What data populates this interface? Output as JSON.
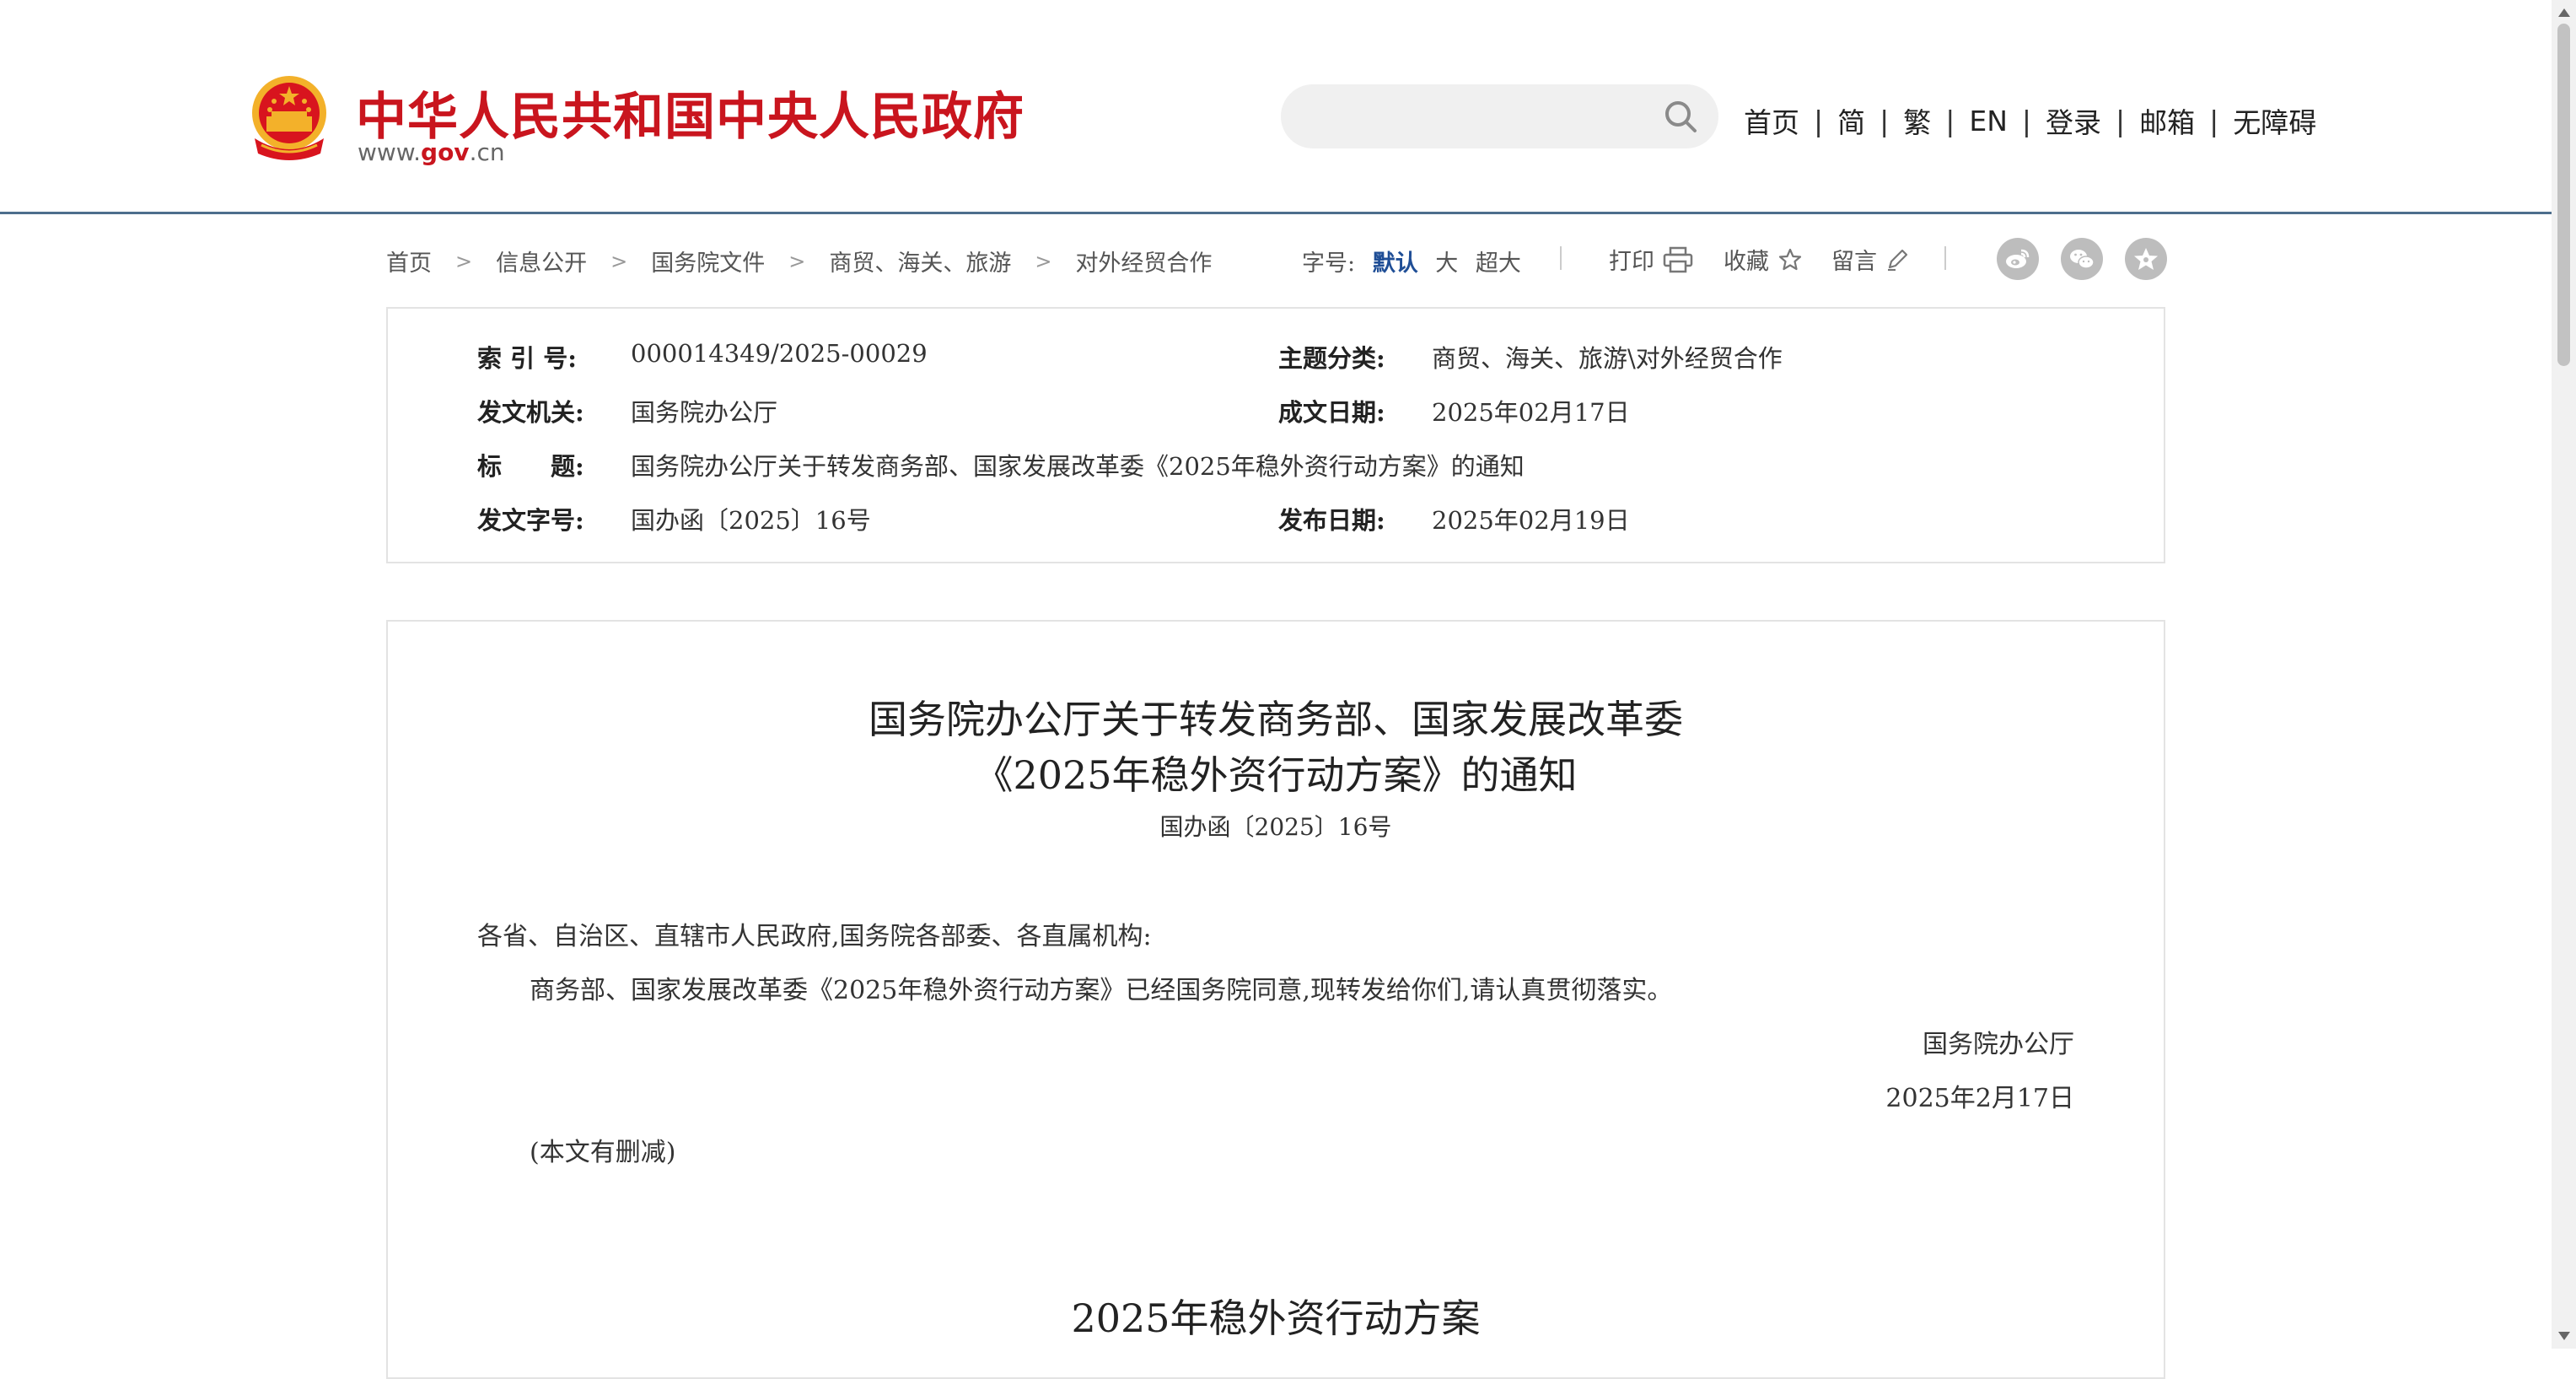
{
  "header": {
    "site_title": "中华人民共和国中央人民政府",
    "site_url_pre": "www.",
    "site_url_mid": "gov",
    "site_url_post": ".cn",
    "search_placeholder": "",
    "nav": [
      {
        "label": "首页"
      },
      {
        "label": "简"
      },
      {
        "label": "繁"
      },
      {
        "label": "EN"
      },
      {
        "label": "登录"
      },
      {
        "label": "邮箱"
      },
      {
        "label": "无障碍"
      }
    ],
    "nav_separator": "|"
  },
  "breadcrumb": {
    "items": [
      "首页",
      "信息公开",
      "国务院文件",
      "商贸、海关、旅游",
      "对外经贸合作"
    ],
    "chevron": ">"
  },
  "toolbar": {
    "fontsize_label": "字号:",
    "fontsize_options": [
      {
        "label": "默认",
        "active": true
      },
      {
        "label": "大",
        "active": false
      },
      {
        "label": "超大",
        "active": false
      }
    ],
    "print_label": "打印",
    "favorite_label": "收藏",
    "comment_label": "留言",
    "share_icons": [
      "weibo-icon",
      "wechat-icon",
      "star-icon"
    ]
  },
  "meta": {
    "index_label": "索 引 号:",
    "index_value": "000014349/2025-00029",
    "topic_label": "主题分类:",
    "topic_value": "商贸、海关、旅游\\对外经贸合作",
    "issuer_label": "发文机关:",
    "issuer_value": "国务院办公厅",
    "created_label": "成文日期:",
    "created_value": "2025年02月17日",
    "title_label": "标　　题:",
    "title_value": "国务院办公厅关于转发商务部、国家发展改革委《2025年稳外资行动方案》的通知",
    "docno_label": "发文字号:",
    "docno_value": "国办函〔2025〕16号",
    "published_label": "发布日期:",
    "published_value": "2025年02月19日"
  },
  "article": {
    "title_line1": "国务院办公厅关于转发商务部、国家发展改革委",
    "title_line2": "《2025年稳外资行动方案》的通知",
    "doc_number": "国办函〔2025〕16号",
    "salutation": "各省、自治区、直辖市人民政府,国务院各部委、各直属机构:",
    "body": "商务部、国家发展改革委《2025年稳外资行动方案》已经国务院同意,现转发给你们,请认真贯彻落实。",
    "signer": "国务院办公厅",
    "sign_date": "2025年2月17日",
    "note": "(本文有删减)",
    "section_title": "2025年稳外资行动方案"
  },
  "colors": {
    "brand_red": "#c9151e",
    "header_rule": "#4d6e8c",
    "active_font": "#1f4e96",
    "share_grey": "#bdbdbd"
  }
}
